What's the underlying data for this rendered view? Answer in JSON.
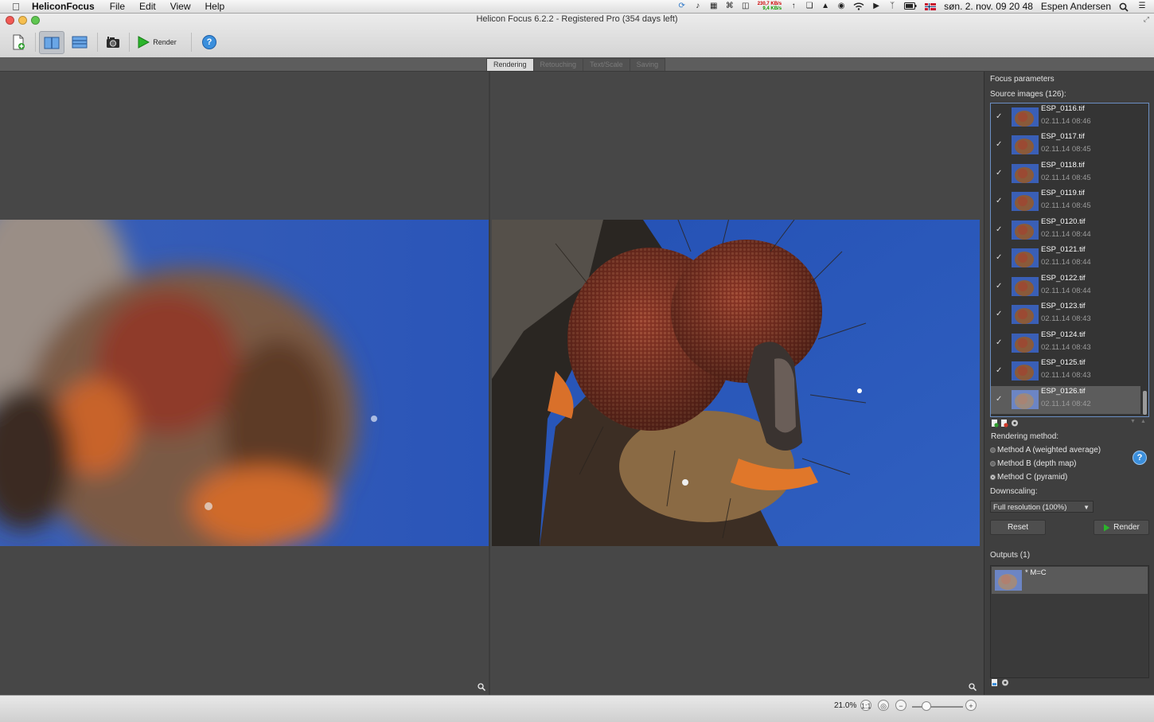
{
  "menubar": {
    "app_name": "HeliconFocus",
    "menus": [
      "File",
      "Edit",
      "View",
      "Help"
    ],
    "net_up": "230,7 KB/s",
    "net_down": "9,4 KB/s",
    "datetime": "søn. 2. nov.  09 20 48",
    "user": "Espen Andersen"
  },
  "window": {
    "title": "Helicon Focus 6.2.2 - Registered Pro  (354 days left)"
  },
  "toolbar": {
    "render_label": "Render",
    "help_symbol": "?"
  },
  "tabs": [
    {
      "label": "Rendering",
      "active": true
    },
    {
      "label": "Retouching",
      "active": false
    },
    {
      "label": "Text/Scale",
      "active": false
    },
    {
      "label": "Saving",
      "active": false
    }
  ],
  "panel": {
    "header": "Focus parameters",
    "source_label": "Source images (126):",
    "source_images": [
      {
        "name": "ESP_0116.tif",
        "date": "02.11.14 08:46",
        "checked": true
      },
      {
        "name": "ESP_0117.tif",
        "date": "02.11.14 08:45",
        "checked": true
      },
      {
        "name": "ESP_0118.tif",
        "date": "02.11.14 08:45",
        "checked": true
      },
      {
        "name": "ESP_0119.tif",
        "date": "02.11.14 08:45",
        "checked": true
      },
      {
        "name": "ESP_0120.tif",
        "date": "02.11.14 08:44",
        "checked": true
      },
      {
        "name": "ESP_0121.tif",
        "date": "02.11.14 08:44",
        "checked": true
      },
      {
        "name": "ESP_0122.tif",
        "date": "02.11.14 08:44",
        "checked": true
      },
      {
        "name": "ESP_0123.tif",
        "date": "02.11.14 08:43",
        "checked": true
      },
      {
        "name": "ESP_0124.tif",
        "date": "02.11.14 08:43",
        "checked": true
      },
      {
        "name": "ESP_0125.tif",
        "date": "02.11.14 08:43",
        "checked": true
      },
      {
        "name": "ESP_0126.tif",
        "date": "02.11.14 08:42",
        "checked": true,
        "selected": true
      }
    ],
    "rendering_method_label": "Rendering method:",
    "methods": [
      {
        "label": "Method A (weighted average)",
        "selected": false
      },
      {
        "label": "Method B (depth map)",
        "selected": false
      },
      {
        "label": "Method C (pyramid)",
        "selected": true
      }
    ],
    "help_symbol": "?",
    "downscaling_label": "Downscaling:",
    "downscaling_value": "Full resolution (100%)",
    "reset_label": "Reset",
    "render_label": "Render",
    "outputs_label": "Outputs (1)",
    "output_item": "* M=C"
  },
  "statusbar": {
    "zoom": "21.0%",
    "zoom_level": 0.2
  },
  "colors": {
    "accent": "#3b8fdc",
    "sky_blue": "#2a55b8",
    "eye_red": "#8b2e22",
    "render_green": "#2bb52b"
  }
}
